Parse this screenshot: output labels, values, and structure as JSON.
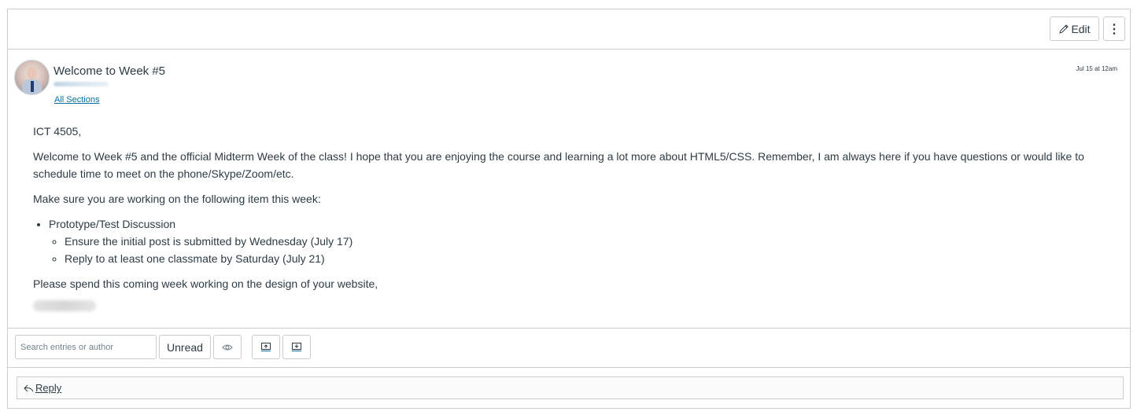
{
  "header": {
    "edit_label": "Edit",
    "edit_icon": "pencil-icon",
    "more_icon": "vertical-ellipsis-icon",
    "more_glyph": "⋮"
  },
  "post": {
    "title": "Welcome to Week #5",
    "sections_link": "All Sections",
    "date": "Jul 15 at 12am",
    "avatar_icon": "user-avatar",
    "body": {
      "greeting": "ICT 4505,",
      "paragraph1": "Welcome to Week #5 and the official Midterm Week of the class!  I hope that you are enjoying the course and learning a lot more about HTML5/CSS.  Remember, I am always here if you have questions or would like to schedule time to meet on the phone/Skype/Zoom/etc.",
      "paragraph2": "Make sure you are working on the following item this week:",
      "list": [
        {
          "label": "Prototype/Test Discussion",
          "subitems": [
            "Ensure the initial post is submitted by Wednesday (July 17)",
            "Reply to at least one classmate by Saturday (July 21)"
          ]
        }
      ],
      "paragraph3": "Please spend this coming week working on the design of your website,"
    }
  },
  "toolbar": {
    "search_placeholder": "Search entries or author",
    "search_value": "",
    "unread_label": "Unread",
    "mark_read_icon": "eye-icon",
    "expand_icon": "collapse-up-icon",
    "collapse_icon": "expand-down-icon"
  },
  "reply": {
    "label": "Reply",
    "icon": "reply-arrow-icon"
  }
}
